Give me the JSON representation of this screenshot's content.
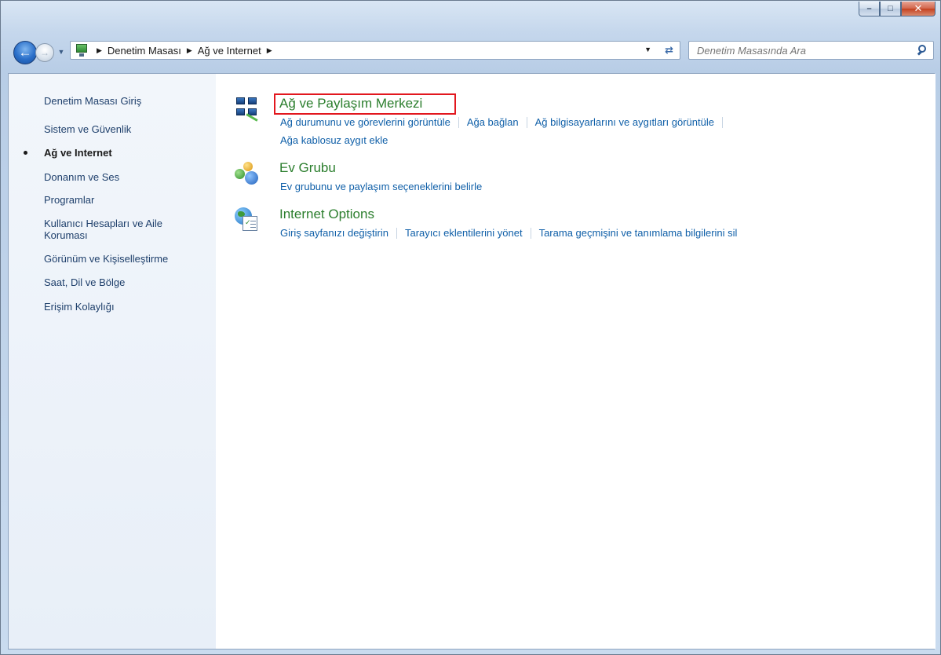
{
  "navbar": {
    "breadcrumbs": [
      "Denetim Masası",
      "Ağ ve Internet"
    ],
    "search_placeholder": "Denetim Masasında Ara"
  },
  "sidebar": {
    "items": [
      {
        "label": "Denetim Masası Giriş"
      },
      {
        "label": "Sistem ve Güvenlik"
      },
      {
        "label": "Ağ ve Internet",
        "active": true
      },
      {
        "label": "Donanım ve Ses"
      },
      {
        "label": "Programlar"
      },
      {
        "label": "Kullanıcı Hesapları ve Aile Koruması"
      },
      {
        "label": "Görünüm ve Kişiselleştirme"
      },
      {
        "label": "Saat, Dil ve Bölge"
      },
      {
        "label": "Erişim Kolaylığı"
      }
    ]
  },
  "categories": [
    {
      "title": "Ağ ve Paylaşım Merkezi",
      "icon": "network-icon",
      "links": [
        "Ağ durumunu ve görevlerini görüntüle",
        "Ağa bağlan",
        "Ağ bilgisayarlarını ve aygıtları görüntüle",
        "Ağa kablosuz aygıt ekle"
      ]
    },
    {
      "title": "Ev Grubu",
      "icon": "homegroup-icon",
      "links": [
        "Ev grubunu ve paylaşım seçeneklerini belirle"
      ]
    },
    {
      "title": "Internet Options",
      "icon": "internet-options-icon",
      "links": [
        "Giriş sayfanızı değiştirin",
        "Tarayıcı eklentilerini yönet",
        "Tarama geçmişini ve tanımlama bilgilerini sil"
      ]
    }
  ],
  "colors": {
    "category_title": "#2b7e2d",
    "link": "#0f5fa8",
    "highlight": "#e2171e"
  }
}
